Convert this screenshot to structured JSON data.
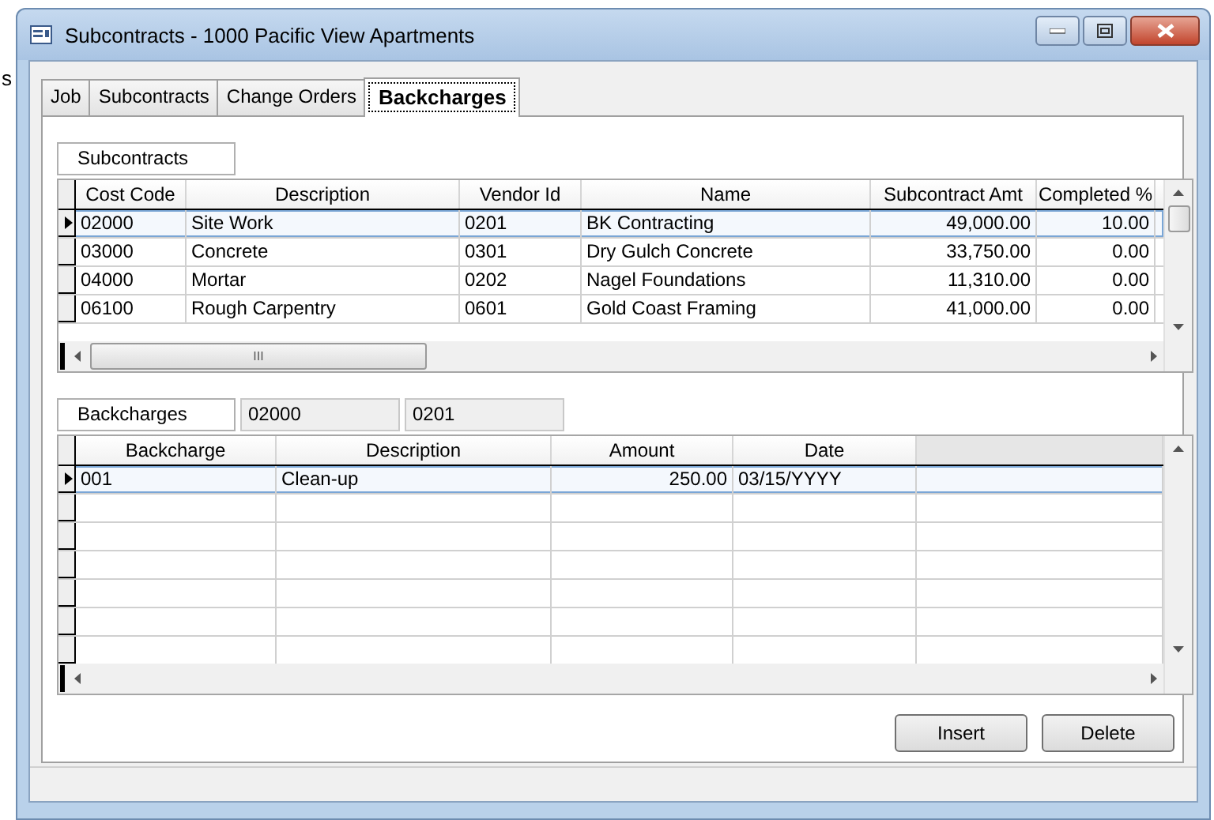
{
  "background_text": "s",
  "window": {
    "title": "Subcontracts - 1000  Pacific View Apartments"
  },
  "tabs": [
    {
      "label": "Job",
      "selected": false
    },
    {
      "label": "Subcontracts",
      "selected": false
    },
    {
      "label": "Change Orders",
      "selected": false
    },
    {
      "label": "Backcharges",
      "selected": true
    }
  ],
  "subcontracts": {
    "label": "Subcontracts",
    "columns": [
      {
        "label": "Cost Code",
        "kind": "text"
      },
      {
        "label": "Description",
        "kind": "text"
      },
      {
        "label": "Vendor Id",
        "kind": "text"
      },
      {
        "label": "Name",
        "kind": "text"
      },
      {
        "label": "Subcontract Amt",
        "kind": "number"
      },
      {
        "label": "Completed %",
        "kind": "number"
      }
    ],
    "rows": [
      {
        "current": true,
        "cells": [
          "02000",
          "Site Work",
          "0201",
          "BK Contracting",
          "49,000.00",
          "10.00"
        ]
      },
      {
        "current": false,
        "cells": [
          "03000",
          "Concrete",
          "0301",
          "Dry Gulch Concrete",
          "33,750.00",
          "0.00"
        ]
      },
      {
        "current": false,
        "cells": [
          "04000",
          "Mortar",
          "0202",
          "Nagel Foundations",
          "11,310.00",
          "0.00"
        ]
      },
      {
        "current": false,
        "cells": [
          "06100",
          "Rough Carpentry",
          "0601",
          "Gold Coast Framing",
          "41,000.00",
          "0.00"
        ]
      }
    ],
    "scroll_label": "III"
  },
  "backcharges": {
    "label": "Backcharges",
    "cost_code": "02000",
    "vendor_id": "0201",
    "columns": [
      {
        "label": "Backcharge",
        "kind": "text"
      },
      {
        "label": "Description",
        "kind": "text"
      },
      {
        "label": "Amount",
        "kind": "number"
      },
      {
        "label": "Date",
        "kind": "text"
      }
    ],
    "rows": [
      {
        "current": true,
        "cells": [
          "001",
          "Clean-up",
          "250.00",
          "03/15/YYYY"
        ]
      }
    ]
  },
  "buttons": [
    {
      "label": "Insert"
    },
    {
      "label": "Delete"
    }
  ]
}
